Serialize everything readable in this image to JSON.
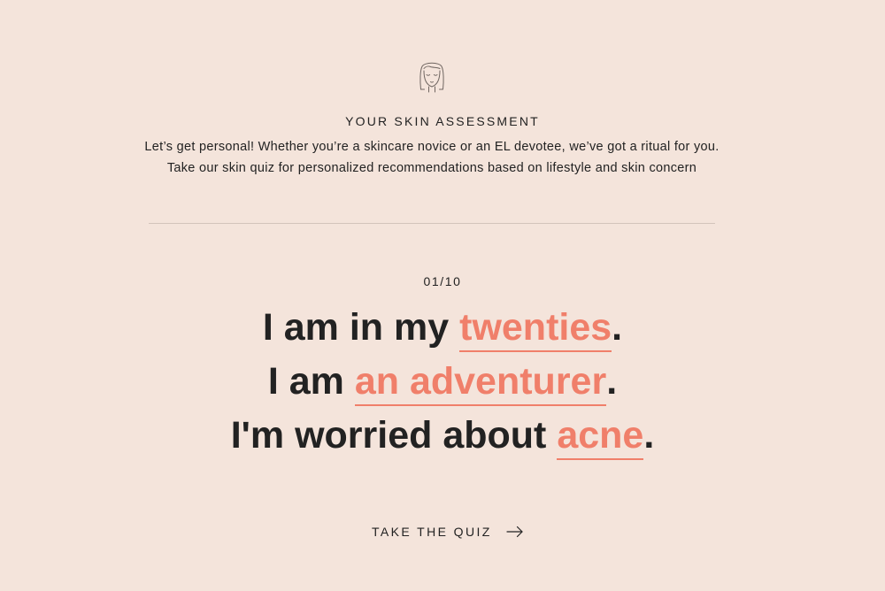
{
  "header": {
    "icon": "face-icon",
    "title": "YOUR SKIN ASSESSMENT",
    "intro": "Let’s get personal! Whether you’re a skincare novice or an EL devotee, we’ve got a ritual for you. Take our skin quiz for personalized recommendations based on lifestyle and skin concern"
  },
  "quiz": {
    "step": "01/10",
    "statements": [
      {
        "prefix": "I am in my ",
        "choice": "twenties",
        "suffix": "."
      },
      {
        "prefix": "I am ",
        "choice": "an adventurer",
        "suffix": "."
      },
      {
        "prefix": "I'm worried about ",
        "choice": "acne",
        "suffix": "."
      }
    ],
    "cta": {
      "label": "TAKE THE QUIZ",
      "icon": "arrow-right-icon"
    }
  },
  "colors": {
    "background": "#f4e4db",
    "text": "#222222",
    "accent": "#f07f6a",
    "divider": "#d3c4bb"
  }
}
